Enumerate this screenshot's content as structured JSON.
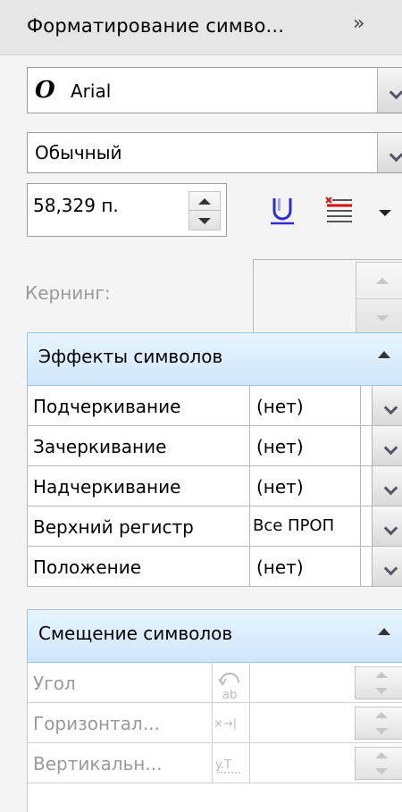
{
  "panel": {
    "title": "Форматирование симво...",
    "collapse_glyph": "»"
  },
  "font": {
    "name": "Arial",
    "icon": "opentype-font-icon",
    "icon_glyph": "O"
  },
  "style": {
    "value": "Обычный"
  },
  "size": {
    "value": "58,329 п."
  },
  "kerning": {
    "label": "Кернинг:",
    "value": ""
  },
  "effects": {
    "title": "Эффекты символов",
    "rows": [
      {
        "label": "Подчеркивание",
        "value": "(нет)"
      },
      {
        "label": "Зачеркивание",
        "value": "(нет)"
      },
      {
        "label": "Надчеркивание",
        "value": "(нет)"
      },
      {
        "label": "Верхний регистр",
        "value": "Все ПРОП"
      },
      {
        "label": "Положение",
        "value": "(нет)"
      }
    ]
  },
  "shift": {
    "title": "Смещение символов",
    "rows": [
      {
        "label": "Угол",
        "icon": "rotate-angle-icon"
      },
      {
        "label": "Горизонтал...",
        "icon": "horizontal-shift-icon"
      },
      {
        "label": "Вертикальн...",
        "icon": "vertical-shift-icon"
      }
    ]
  },
  "colors": {
    "accent": "#cfe6fb",
    "underline_icon": "#2b2bd0",
    "strike_icon": "#d01010"
  }
}
